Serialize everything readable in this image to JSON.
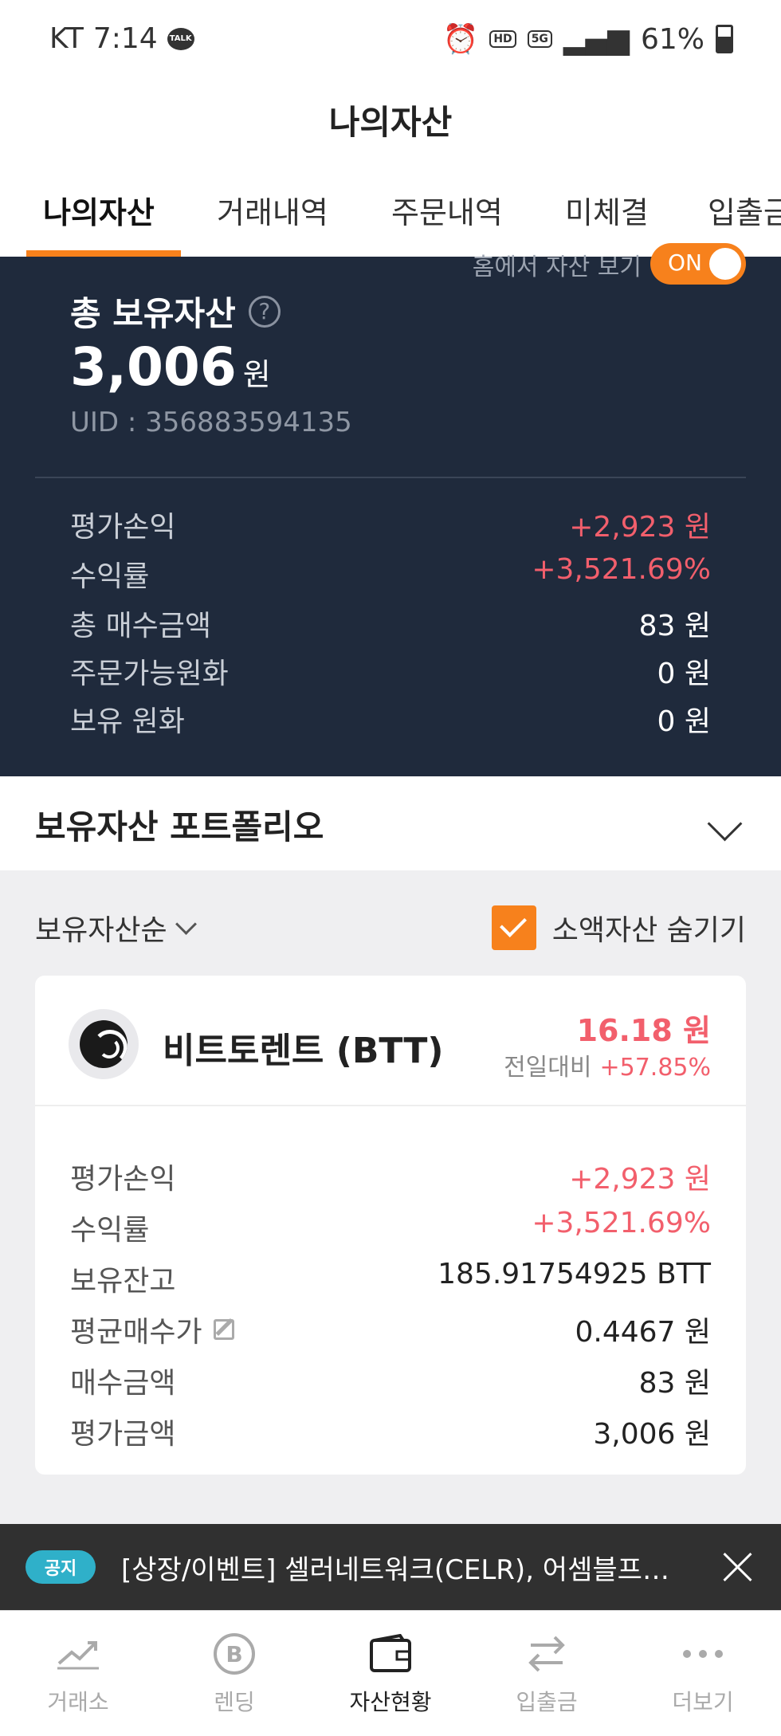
{
  "status_bar": {
    "carrier": "KT",
    "time": "7:14",
    "talk_badge": "TALK",
    "hd": "HD",
    "net": "5G",
    "battery": "61%"
  },
  "header": {
    "title": "나의자산"
  },
  "tabs": [
    {
      "label": "나의자산",
      "active": true
    },
    {
      "label": "거래내역"
    },
    {
      "label": "주문내역"
    },
    {
      "label": "미체결"
    },
    {
      "label": "입출금"
    }
  ],
  "summary": {
    "home_toggle_label": "홈에서 자산 보기",
    "toggle_state": "ON",
    "total_label": "총 보유자산",
    "help": "?",
    "total_value": "3,006",
    "unit": "원",
    "uid": "UID : 356883594135",
    "rows": [
      {
        "label": "평가손익",
        "value": "+2,923 원",
        "positive": true
      },
      {
        "label": "수익률",
        "value": "+3,521.69%",
        "positive": true
      },
      {
        "label": "총 매수금액",
        "value": "83 원"
      },
      {
        "label": "주문가능원화",
        "value": "0 원"
      },
      {
        "label": "보유 원화",
        "value": "0 원"
      }
    ]
  },
  "portfolio": {
    "title": "보유자산 포트폴리오"
  },
  "list_controls": {
    "sort_label": "보유자산순",
    "hide_small_label": "소액자산 숨기기",
    "hide_small_checked": true
  },
  "asset": {
    "name": "비트토렌트 (BTT)",
    "price": "16.18 원",
    "change_label": "전일대비",
    "change_value": "+57.85%",
    "rows": [
      {
        "label": "평가손익",
        "value": "+2,923 원",
        "positive": true
      },
      {
        "label": "수익률",
        "value": "+3,521.69%",
        "positive": true
      },
      {
        "label": "보유잔고",
        "value": "185.91754925 BTT"
      },
      {
        "label": "평균매수가",
        "value": "0.4467 원",
        "editable": true
      },
      {
        "label": "매수금액",
        "value": "83 원"
      },
      {
        "label": "평가금액",
        "value": "3,006 원"
      }
    ]
  },
  "notice": {
    "badge": "공지",
    "text": "[상장/이벤트] 셀러네트워크(CELR), 어셈블프로토…"
  },
  "bottom_nav": [
    {
      "label": "거래소",
      "icon": "chart-trend-icon"
    },
    {
      "label": "렌딩",
      "icon": "bitcoin-coin-icon"
    },
    {
      "label": "자산현황",
      "icon": "wallet-icon",
      "active": true
    },
    {
      "label": "입출금",
      "icon": "transfer-arrows-icon"
    },
    {
      "label": "더보기",
      "icon": "more-dots-icon"
    }
  ],
  "colors": {
    "accent": "#f7811c",
    "positive": "#f25f6c",
    "summary_bg": "#1f2a3c",
    "notice_badge": "#2fb0c9"
  }
}
